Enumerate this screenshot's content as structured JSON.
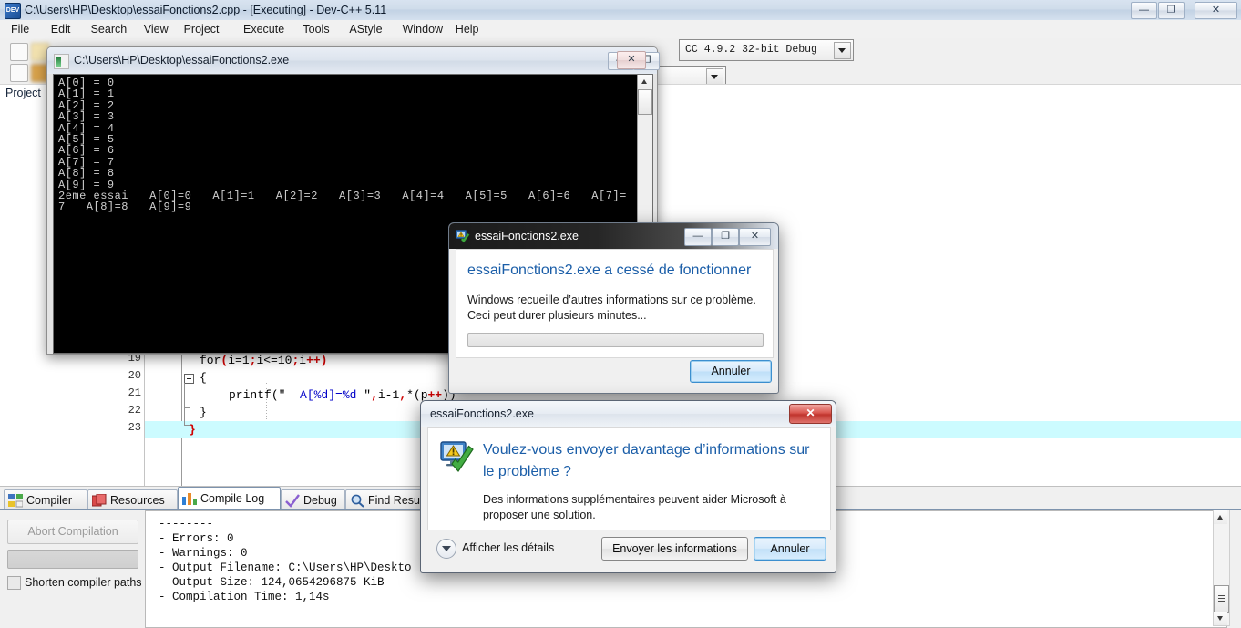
{
  "app": {
    "title": "C:\\Users\\HP\\Desktop\\essaiFonctions2.cpp - [Executing] - Dev-C++ 5.11",
    "icon": "devcpp-icon",
    "window_buttons": {
      "minimize": "—",
      "maximize": "❐",
      "close": "✕"
    },
    "menu": [
      "File",
      "Edit",
      "Search",
      "View",
      "Project",
      "Execute",
      "Tools",
      "AStyle",
      "Window",
      "Help"
    ],
    "compiler_combo": {
      "value": "CC 4.9.2 32-bit Debug"
    },
    "project_panel": {
      "tab_label": "Project"
    }
  },
  "editor": {
    "lines": [
      {
        "no": "19",
        "indent": 0,
        "parts": [
          {
            "t": "for",
            "c": "plain"
          },
          {
            "t": "(",
            "c": "red"
          },
          {
            "t": "i=1",
            "c": "plain"
          },
          {
            "t": ";",
            "c": "red"
          },
          {
            "t": "i<=10",
            "c": "plain"
          },
          {
            "t": ";",
            "c": "red"
          },
          {
            "t": "i",
            "c": "plain"
          },
          {
            "t": "++)",
            "c": "red"
          }
        ]
      },
      {
        "no": "20",
        "indent": 0,
        "parts": [
          {
            "t": "{",
            "c": "plain"
          }
        ]
      },
      {
        "no": "21",
        "indent": 1,
        "parts": [
          {
            "t": "printf",
            "c": "plain"
          },
          {
            "t": "(",
            "c": "plain"
          },
          {
            "t": "\"  ",
            "c": "plain"
          },
          {
            "t": "A[%d]=%d",
            "c": "blue"
          },
          {
            "t": " \"",
            "c": "plain"
          },
          {
            "t": ",",
            "c": "red"
          },
          {
            "t": "i-1",
            "c": "plain"
          },
          {
            "t": ",",
            "c": "red"
          },
          {
            "t": "*(p",
            "c": "plain"
          },
          {
            "t": "++",
            "c": "red"
          },
          {
            "t": "))",
            "c": "plain"
          }
        ]
      },
      {
        "no": "22",
        "indent": 0,
        "parts": [
          {
            "t": "}",
            "c": "plain"
          }
        ]
      },
      {
        "no": "23",
        "indent": -1,
        "parts": [
          {
            "t": "}",
            "c": "red"
          }
        ]
      }
    ]
  },
  "console": {
    "title": "C:\\Users\\HP\\Desktop\\essaiFonctions2.exe",
    "icon": "console-icon",
    "window_buttons": {
      "minimize": "—",
      "maximize": "❐",
      "close": "✕"
    },
    "lines": [
      "A[0] = 0",
      "A[1] = 1",
      "A[2] = 2",
      "A[3] = 3",
      "A[4] = 4",
      "A[5] = 5",
      "A[6] = 6",
      "A[7] = 7",
      "A[8] = 8",
      "A[9] = 9",
      "2eme essai   A[0]=0   A[1]=1   A[2]=2   A[3]=3   A[4]=4   A[5]=5   A[6]=6   A[7]=",
      "7   A[8]=8   A[9]=9"
    ]
  },
  "bottom_panel": {
    "tabs": [
      {
        "label": "Compiler",
        "icon": "compiler-icon",
        "active": false
      },
      {
        "label": "Resources",
        "icon": "resources-icon",
        "active": false
      },
      {
        "label": "Compile Log",
        "icon": "compile-log-icon",
        "active": true
      },
      {
        "label": "Debug",
        "icon": "debug-check-icon",
        "active": false
      },
      {
        "label": "Find Results",
        "icon": "find-results-icon",
        "active": false
      }
    ],
    "abort_button": "Abort Compilation",
    "shorten_checkbox_label": "Shorten compiler paths",
    "log_lines": [
      "--------",
      "- Errors: 0",
      "- Warnings: 0",
      "- Output Filename: C:\\Users\\HP\\Deskto",
      "- Output Size: 124,0654296875 KiB",
      "- Compilation Time: 1,14s"
    ]
  },
  "dialog_stopped_working": {
    "title": "essaiFonctions2.exe",
    "icon": "error-report-icon",
    "window_buttons": {
      "minimize": "—",
      "maximize": "❐",
      "close": "✕"
    },
    "heading": "essaiFonctions2.exe a cessé de fonctionner",
    "body": "Windows recueille d’autres informations sur ce problème. Ceci peut durer plusieurs minutes...",
    "cancel_button": "Annuler"
  },
  "dialog_send_info": {
    "title": "essaiFonctions2.exe",
    "close_button": "✕",
    "icon": "monitor-warning-check-icon",
    "heading": "Voulez-vous envoyer davantage d’informations sur le problème ?",
    "body": "Des informations supplémentaires peuvent aider Microsoft à proposer une solution.",
    "details_link": "Afficher les détails",
    "send_button": "Envoyer les informations",
    "cancel_button": "Annuler"
  },
  "colors": {
    "accent_blue": "#1b5ea8",
    "current_line": "#ccfbff",
    "console_bg": "#000000",
    "console_fg": "#cfcfcf",
    "close_red": "#c0352e"
  }
}
